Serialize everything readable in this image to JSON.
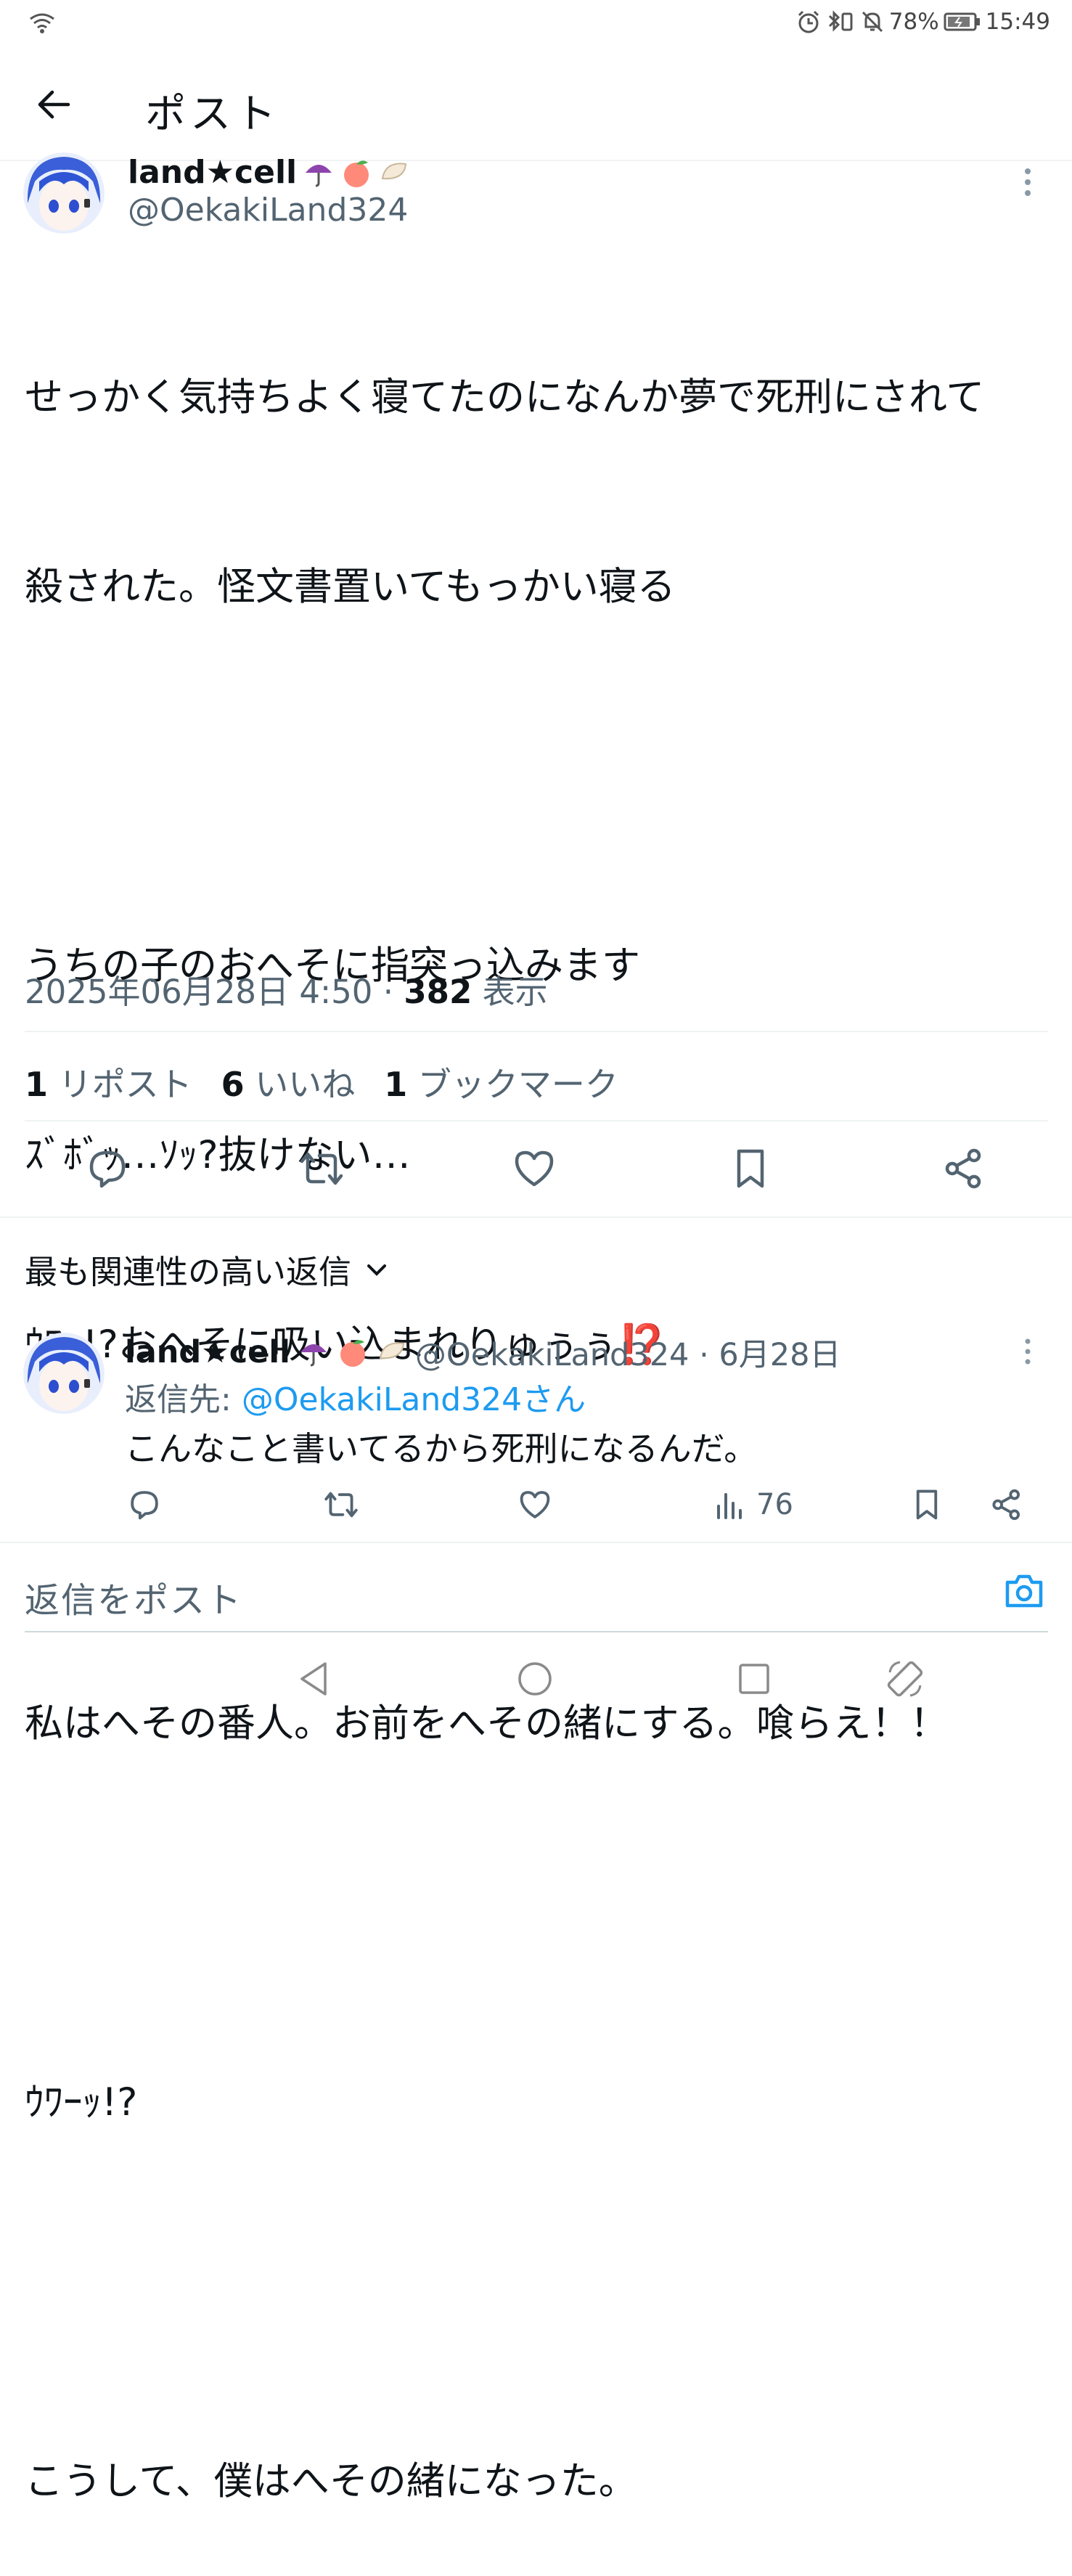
{
  "status_bar": {
    "battery": "78%",
    "time": "15:49"
  },
  "header": {
    "title": "ポスト"
  },
  "tweet": {
    "display_name": "land★cell",
    "handle": "@OekakiLand324",
    "text_lines": [
      "せっかく気持ちよく寝てたのになんか夢で死刑にされて",
      "殺された。怪文書置いてもっかい寝る",
      "",
      "うちの子のおへそに指突っ込みます",
      "ｽﾞﾎﾞｯ…ｿｯ?抜けない…",
      "ｳﾜｯ!?おへそに吸い込まれりゅぅぅ⁉️",
      "",
      "私はへその番人。お前をへその緒にする。喰らえ！！",
      "",
      "ｳﾜｰｯ!?",
      "",
      "こうして、僕はへその緒になった。"
    ],
    "timestamp": "2025年06月28日 4:50",
    "view_count": "382",
    "view_label": "表示",
    "stats": [
      {
        "count": "1",
        "label": "リポスト"
      },
      {
        "count": "6",
        "label": "いいね"
      },
      {
        "count": "1",
        "label": "ブックマーク"
      }
    ]
  },
  "replies_section": {
    "sort_label": "最も関連性の高い返信"
  },
  "reply": {
    "display_name": "land★cell",
    "handle_date": "@OekakiLand324 · 6月28日",
    "reply_to_prefix": "返信先: ",
    "reply_to_handle": "@OekakiLand324さん",
    "text": "こんなこと書いてるから死刑になるんだ。",
    "views": "76"
  },
  "composer": {
    "placeholder": "返信をポスト"
  },
  "colors": {
    "accent": "#1d9bf0",
    "text": "#0f1419",
    "secondary": "#536471"
  }
}
